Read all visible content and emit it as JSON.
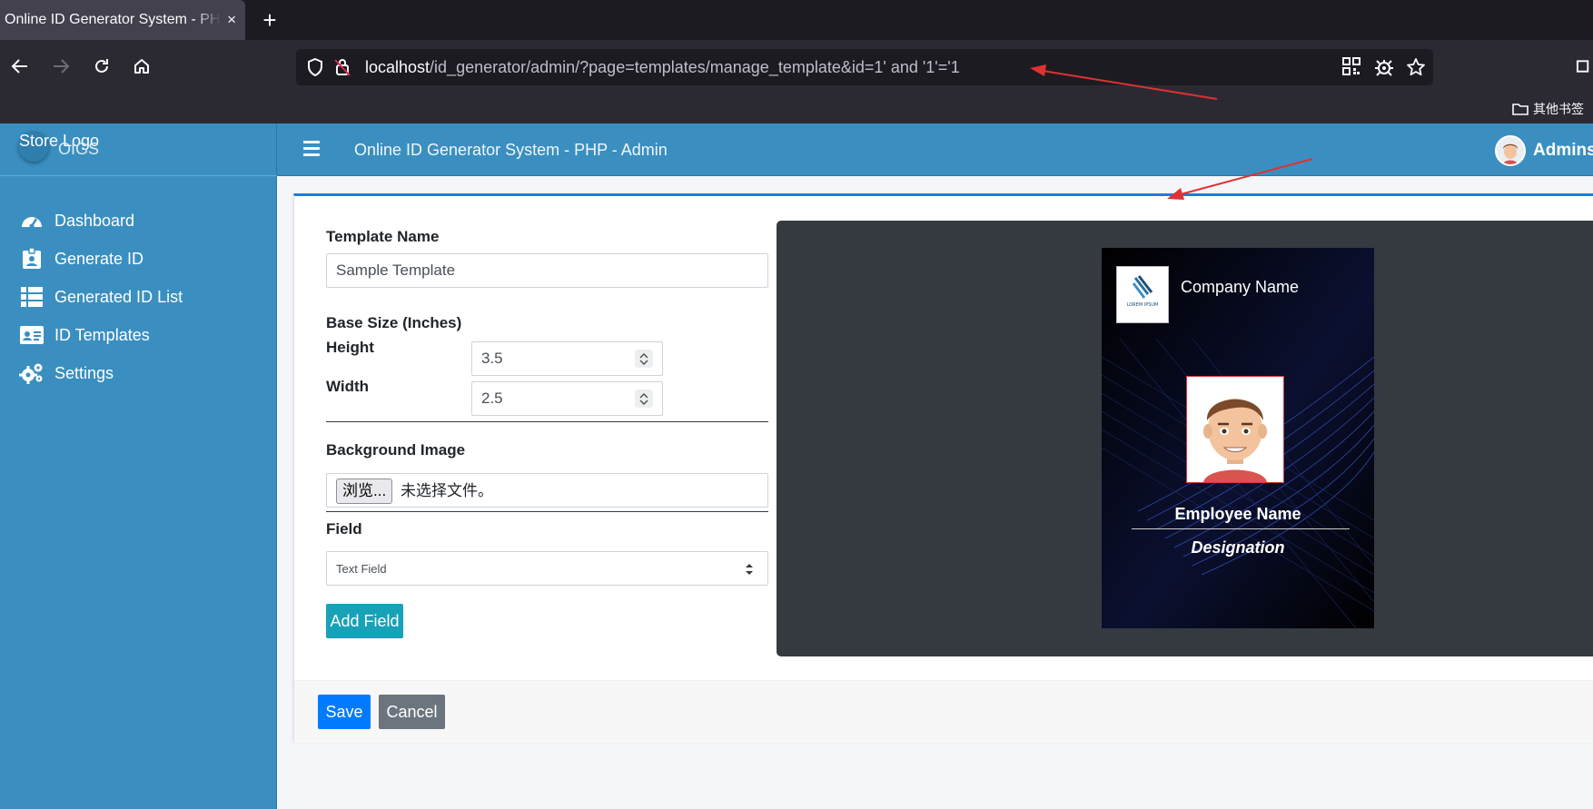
{
  "browser": {
    "tab_title": "Online ID Generator System - PHP - Admin",
    "tab_close": "×",
    "new_tab": "+",
    "url_host": "localhost",
    "url_rest": "/id_generator/admin/?page=templates/manage_template&id=1' and '1'='1",
    "bookmark_folder": "其他书签"
  },
  "sidebar": {
    "brand_alt": "Store Logo",
    "brand_text": "OIGS",
    "items": [
      {
        "label": "Dashboard",
        "icon": "tachometer-icon"
      },
      {
        "label": "Generate ID",
        "icon": "id-badge-icon"
      },
      {
        "label": "Generated ID List",
        "icon": "table-list-icon"
      },
      {
        "label": "ID Templates",
        "icon": "id-card-icon"
      },
      {
        "label": "Settings",
        "icon": "cogs-icon"
      }
    ]
  },
  "topnav": {
    "title": "Online ID Generator System - PHP - Admin",
    "user_name": "Adminstrator"
  },
  "form": {
    "template_name_label": "Template Name",
    "template_name_value": "Sample Template",
    "base_size_label": "Base Size (Inches)",
    "height_label": "Height",
    "height_value": "3.5",
    "width_label": "Width",
    "width_value": "2.5",
    "bg_image_label": "Background Image",
    "file_button": "浏览...",
    "file_status": "未选择文件。",
    "field_label": "Field",
    "field_selected": "Text Field",
    "add_field_button": "Add Field"
  },
  "preview": {
    "company_name": "Company Name",
    "logo_text": "LOREM IPSUM",
    "employee_name": "Employee Name",
    "designation": "Designation"
  },
  "footer": {
    "save_button": "Save",
    "cancel_button": "Cancel"
  },
  "colors": {
    "sidebar": "#3a8fc0",
    "primary": "#007bff",
    "info": "#17a2b8",
    "secondary": "#6c757d",
    "card_accent": "#1d7ce0",
    "annotation": "#e03131"
  }
}
